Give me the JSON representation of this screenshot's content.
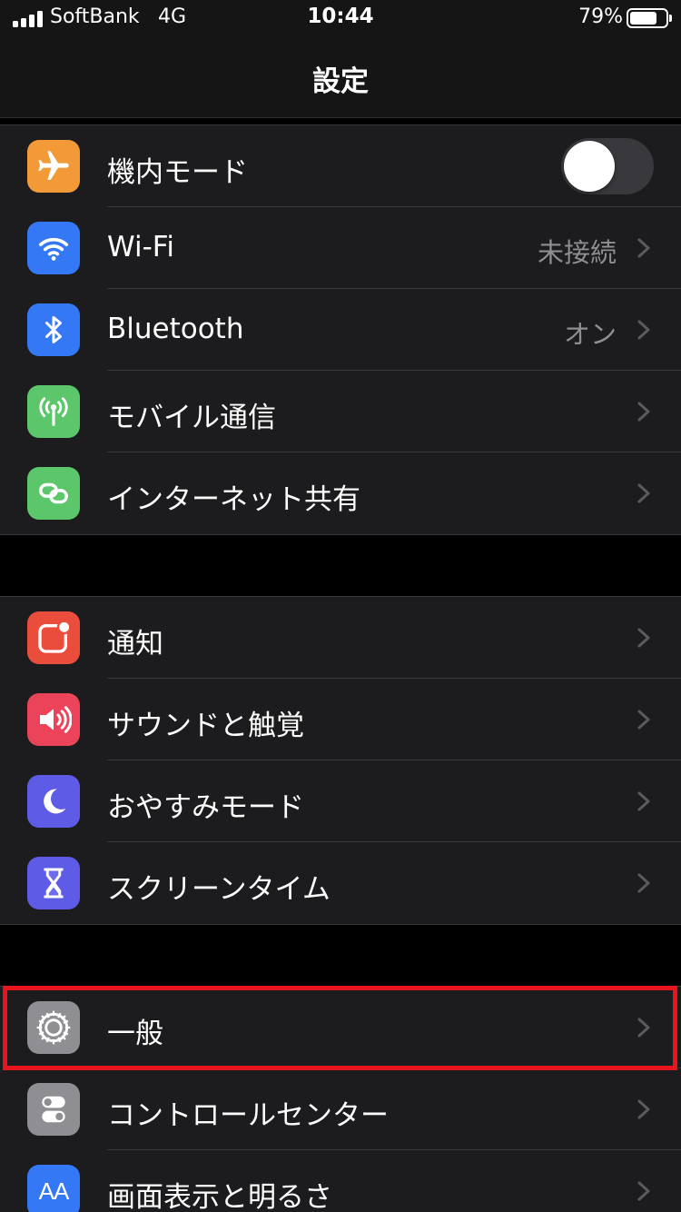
{
  "status_bar": {
    "carrier": "SoftBank",
    "network": "4G",
    "time": "10:44",
    "battery_percent": "79%",
    "battery_level": 0.79
  },
  "nav": {
    "title": "設定"
  },
  "groups": [
    {
      "rows": [
        {
          "label": "機内モード",
          "icon": "airplane-icon",
          "icon_color": "#F19A37",
          "toggle_on": false
        },
        {
          "label": "Wi-Fi",
          "value": "未接続",
          "icon": "wifi-icon",
          "icon_color": "#3478F6"
        },
        {
          "label": "Bluetooth",
          "value": "オン",
          "icon": "bluetooth-icon",
          "icon_color": "#3478F6"
        },
        {
          "label": "モバイル通信",
          "icon": "cellular-antenna-icon",
          "icon_color": "#5CC76A"
        },
        {
          "label": "インターネット共有",
          "icon": "link-chain-icon",
          "icon_color": "#5CC76A"
        }
      ]
    },
    {
      "rows": [
        {
          "label": "通知",
          "icon": "notification-icon",
          "icon_color": "#EB4D3D"
        },
        {
          "label": "サウンドと触覚",
          "icon": "speaker-icon",
          "icon_color": "#EB445A"
        },
        {
          "label": "おやすみモード",
          "icon": "moon-icon",
          "icon_color": "#5E5CE6"
        },
        {
          "label": "スクリーンタイム",
          "icon": "hourglass-icon",
          "icon_color": "#5E5CE6"
        }
      ]
    },
    {
      "rows": [
        {
          "label": "一般",
          "icon": "gear-icon",
          "icon_color": "#8E8E93"
        },
        {
          "label": "コントロールセンター",
          "icon": "toggles-icon",
          "icon_color": "#8E8E93"
        },
        {
          "label": "画面表示と明るさ",
          "icon": "text-size-icon",
          "icon_color": "#3478F6",
          "icon_text": "AA"
        }
      ]
    }
  ],
  "highlight_color": "#E8141E"
}
